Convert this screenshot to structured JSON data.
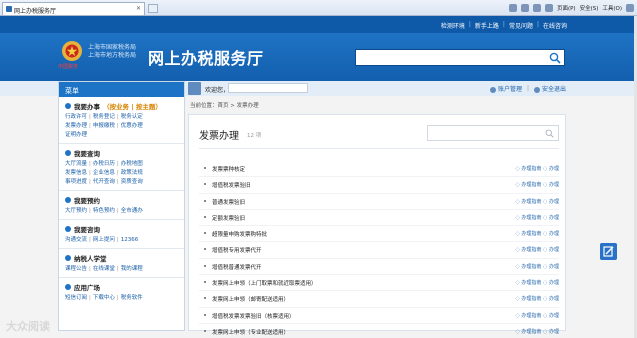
{
  "browser": {
    "tab_title": "网上办税服务厅",
    "tools": [
      "页面(P)",
      "安全(S)",
      "工具(O)"
    ]
  },
  "topbar": {
    "links": [
      "检测环境",
      "新手上路",
      "常见问题",
      "在线咨询"
    ]
  },
  "header": {
    "agency_line1": "上海市国家税务局",
    "agency_line2": "上海市地方税务局",
    "emblem_caption": "中国税务",
    "site_title": "网上办税服务厅"
  },
  "welcome": {
    "label": "欢迎您，",
    "account_manage": "账户管理",
    "logout": "安全退出"
  },
  "sidebar": {
    "header": "菜单",
    "groups": [
      {
        "title": "我要办事",
        "suffix": "（按业务 | 按主题）",
        "lines": [
          [
            "行政许可",
            "税务登记",
            "税务认定"
          ],
          [
            "发票办理",
            "申报缴税",
            "优惠办理"
          ],
          [
            "证明办理"
          ]
        ]
      },
      {
        "title": "我要查询",
        "suffix": "",
        "lines": [
          [
            "大厅流量",
            "办税日历",
            "办税地图"
          ],
          [
            "发票信息",
            "企业信息",
            "政策法规"
          ],
          [
            "事项进度",
            "代开查询",
            "资质查询"
          ]
        ]
      },
      {
        "title": "我要预约",
        "suffix": "",
        "lines": [
          [
            "大厅预约",
            "特色预约",
            "全市通办"
          ]
        ]
      },
      {
        "title": "我要咨询",
        "suffix": "",
        "lines": [
          [
            "沟通交流",
            "网上提问",
            "12366"
          ]
        ]
      },
      {
        "title": "纳税人学堂",
        "suffix": "",
        "lines": [
          [
            "课程公告",
            "在线课堂",
            "我的课程"
          ]
        ]
      },
      {
        "title": "应用广场",
        "suffix": "",
        "lines": [
          [
            "短信订阅",
            "下载中心",
            "税务软件"
          ]
        ]
      }
    ]
  },
  "breadcrumb": "当前位置：首页 > 发票办理",
  "content": {
    "title": "发票办理",
    "count": "12 项",
    "items": [
      "发票票种核定",
      "增值税发票验旧",
      "普通发票验旧",
      "定额发票验旧",
      "超限量申购发票购特批",
      "增值税专用发票代开",
      "增值税普通发票代开",
      "发票网上申领（上门取票和就近取票适用）",
      "发票网上申领（邮寄配送适用）",
      "增值税发票发票验旧（核票适用）",
      "发票网上申领（专业配送适用）"
    ],
    "action1": "办理指南",
    "action2": "办理"
  },
  "watermark": "大众阅读",
  "colors": {
    "brand": "#0f5aa8",
    "menu": "#1d74c7"
  }
}
